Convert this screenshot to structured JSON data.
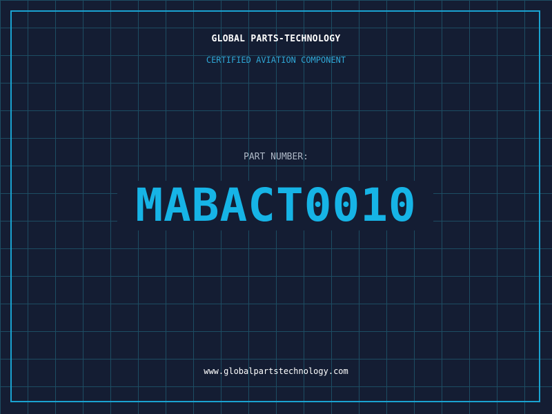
{
  "header": {
    "company": "GLOBAL PARTS-TECHNOLOGY",
    "tagline": "CERTIFIED AVIATION COMPONENT"
  },
  "part": {
    "label": "PART NUMBER:",
    "number": "MABACT0010"
  },
  "footer": {
    "website": "www.globalpartstechnology.com"
  },
  "colors": {
    "background": "#141d33",
    "grid": "#1d4d63",
    "accent": "#16b4e6",
    "frame": "#1aa3d1"
  }
}
